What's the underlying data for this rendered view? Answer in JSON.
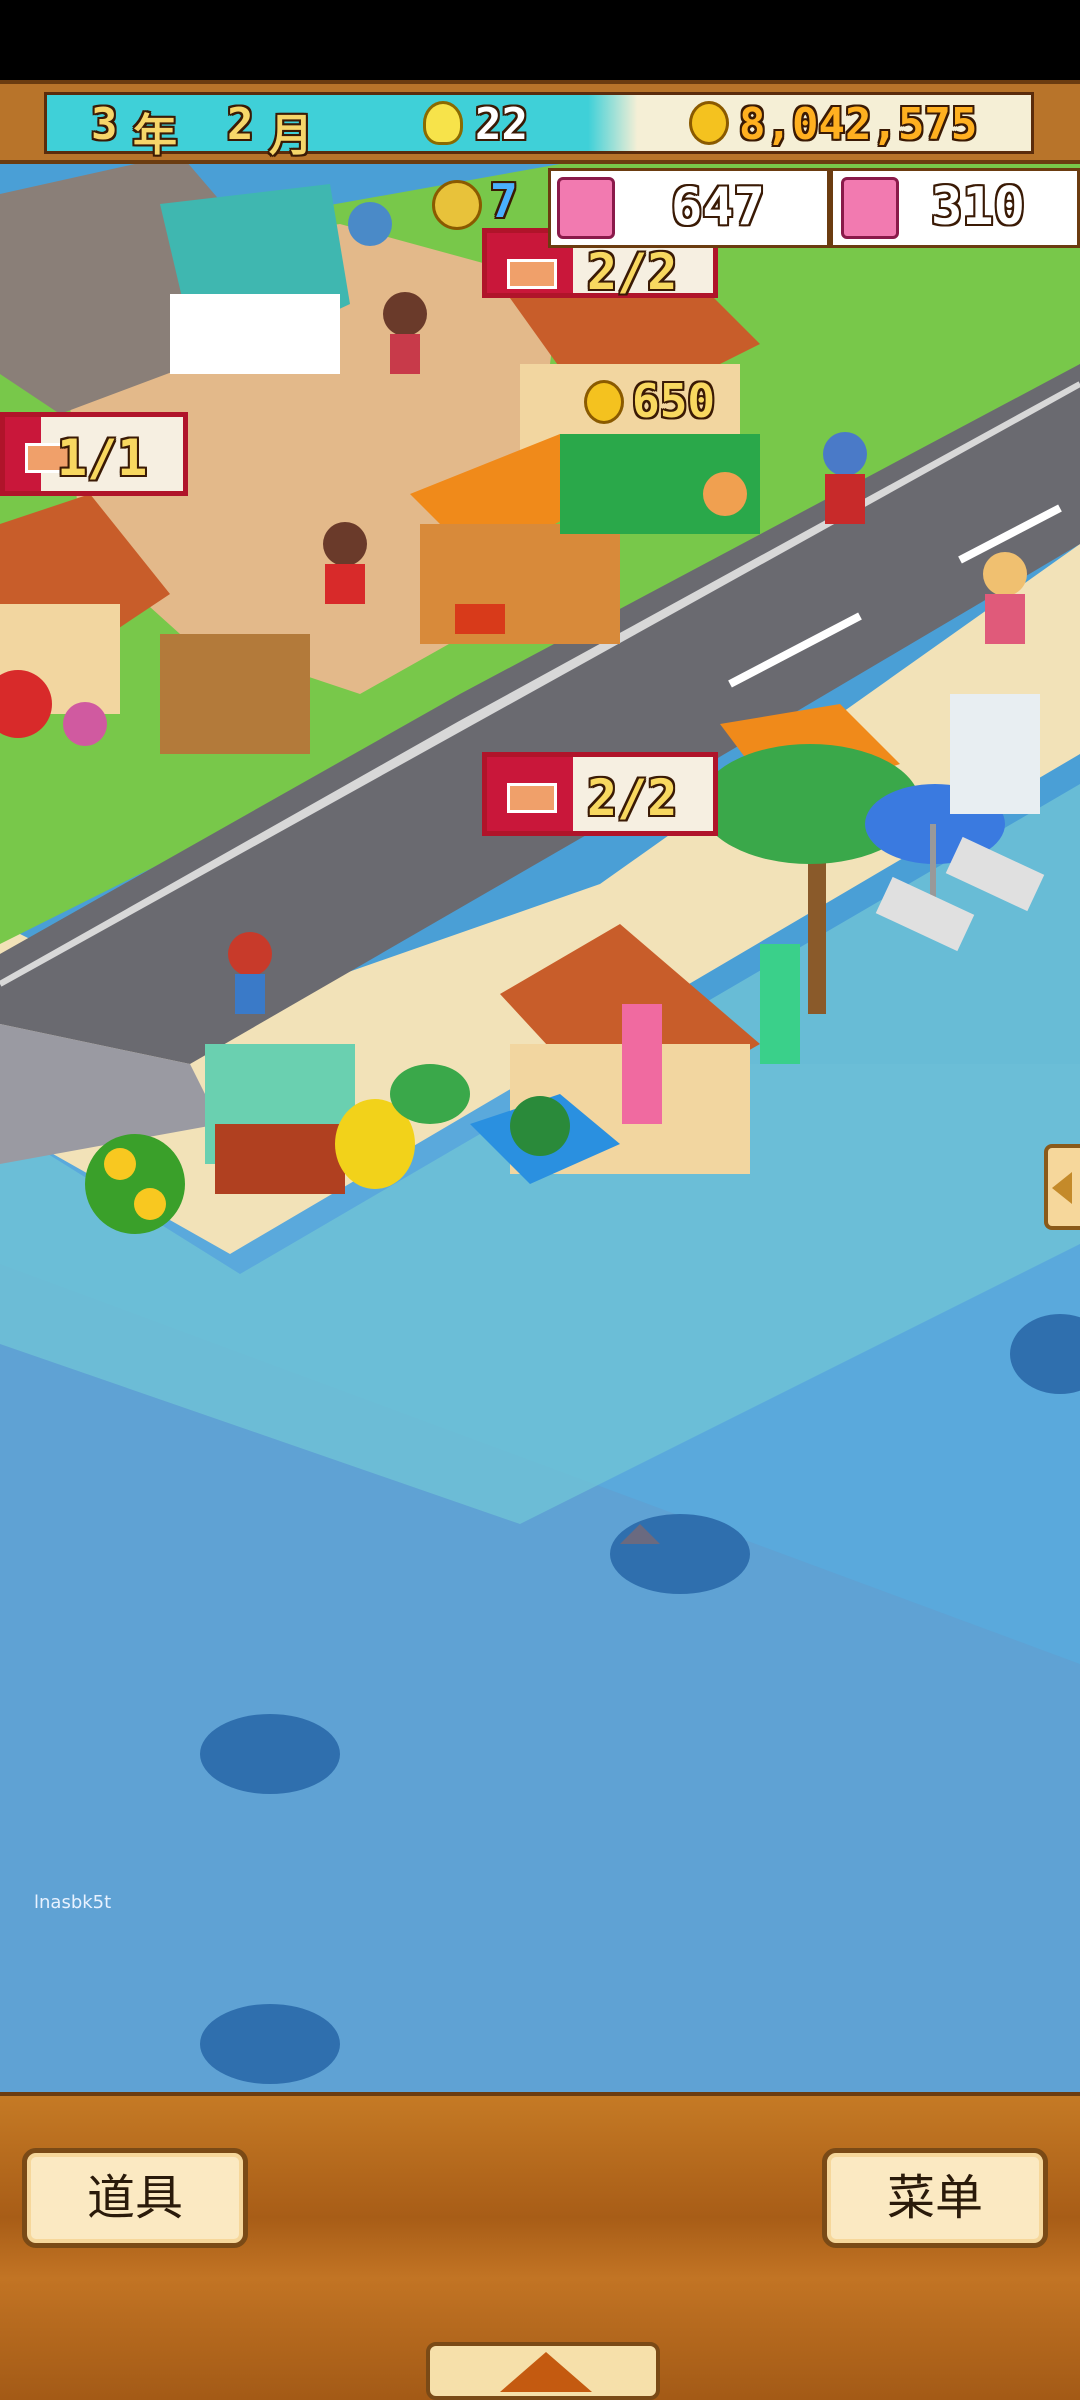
{
  "hud": {
    "year_num": "3",
    "year_unit": "年",
    "month_num": "2",
    "month_unit": "月",
    "ideas": "22",
    "gold": "8,042,575",
    "icons": [
      "calendar",
      "bulb-icon",
      "coin-icon"
    ]
  },
  "stats": {
    "medal_count": "7",
    "hearts": "647",
    "water": "310"
  },
  "map_labels": {
    "room_top": "2/2",
    "room_left": "1/1",
    "room_mid": "2/2",
    "coin_popup": "650"
  },
  "watermark": "lnasbk5t",
  "bottom": {
    "items_label": "道具",
    "menu_label": "菜单"
  },
  "colors": {
    "hud_cyan": "#3fd0d8",
    "wood": "#b8742a",
    "tag_red": "#b0142a",
    "sea": "#4aa3d8",
    "sand": "#f2e2b8",
    "grass": "#78c84a"
  }
}
